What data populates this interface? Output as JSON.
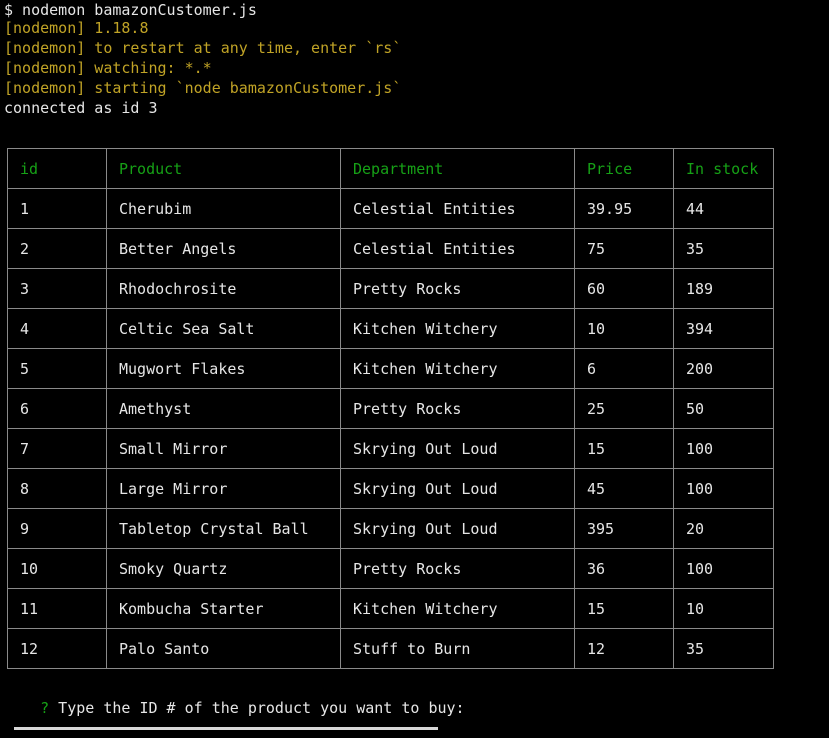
{
  "colors": {
    "background": "#000000",
    "text": "#e6e6e6",
    "nodemon_yellow": "#c0a326",
    "header_green": "#16a116",
    "border": "#8a8a8a"
  },
  "terminal": {
    "command": "$ nodemon bamazonCustomer.js",
    "nodemon_lines": [
      "[nodemon] 1.18.8",
      "[nodemon] to restart at any time, enter `rs`",
      "[nodemon] watching: *.*",
      "[nodemon] starting `node bamazonCustomer.js`"
    ],
    "connected": "connected as id 3"
  },
  "table": {
    "columns": [
      "id",
      "Product",
      "Department",
      "Price",
      "In stock"
    ],
    "rows": [
      [
        "1",
        "Cherubim",
        "Celestial Entities",
        "39.95",
        "44"
      ],
      [
        "2",
        "Better Angels",
        "Celestial Entities",
        "75",
        "35"
      ],
      [
        "3",
        "Rhodochrosite",
        "Pretty Rocks",
        "60",
        "189"
      ],
      [
        "4",
        "Celtic Sea Salt",
        "Kitchen Witchery",
        "10",
        "394"
      ],
      [
        "5",
        "Mugwort Flakes",
        "Kitchen Witchery",
        "6",
        "200"
      ],
      [
        "6",
        "Amethyst",
        "Pretty Rocks",
        "25",
        "50"
      ],
      [
        "7",
        "Small Mirror",
        "Skrying Out Loud",
        "15",
        "100"
      ],
      [
        "8",
        "Large Mirror",
        "Skrying Out Loud",
        "45",
        "100"
      ],
      [
        "9",
        "Tabletop Crystal Ball",
        "Skrying Out Loud",
        "395",
        "20"
      ],
      [
        "10",
        "Smoky Quartz",
        "Pretty Rocks",
        "36",
        "100"
      ],
      [
        "11",
        "Kombucha Starter",
        "Kitchen Witchery",
        "15",
        "10"
      ],
      [
        "12",
        "Palo Santo",
        "Stuff to Burn",
        "12",
        "35"
      ]
    ]
  },
  "prompt": {
    "marker": "?",
    "question": " Type the ID # of the product you want to buy:"
  }
}
